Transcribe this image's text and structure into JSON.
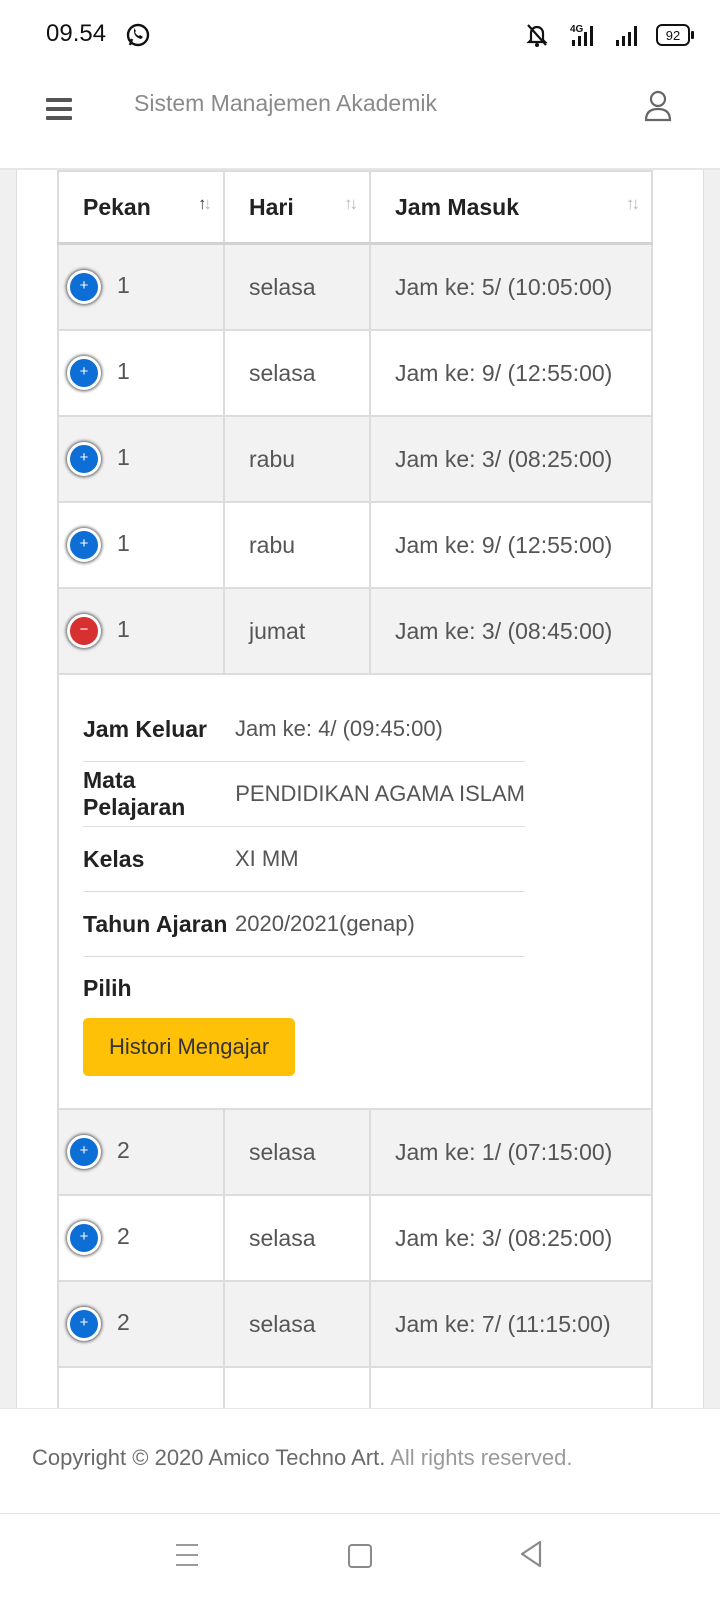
{
  "status_bar": {
    "time": "09.54",
    "battery": "92",
    "network": "4G"
  },
  "header": {
    "title": "Sistem Manajemen Akademik"
  },
  "table": {
    "columns": [
      "Pekan",
      "Hari",
      "Jam Masuk"
    ],
    "rows_before": [
      {
        "pekan": "1",
        "hari": "selasa",
        "jam_masuk": "Jam ke: 5/ (10:05:00)"
      },
      {
        "pekan": "1",
        "hari": "selasa",
        "jam_masuk": "Jam ke: 9/ (12:55:00)"
      },
      {
        "pekan": "1",
        "hari": "rabu",
        "jam_masuk": "Jam ke: 3/ (08:25:00)"
      },
      {
        "pekan": "1",
        "hari": "rabu",
        "jam_masuk": "Jam ke: 9/ (12:55:00)"
      }
    ],
    "expanded_row": {
      "pekan": "1",
      "hari": "jumat",
      "jam_masuk": "Jam ke: 3/ (08:45:00)"
    },
    "detail": {
      "jam_keluar_label": "Jam Keluar",
      "jam_keluar": "Jam ke: 4/ (09:45:00)",
      "mapel_label": "Mata Pelajaran",
      "mapel": "PENDIDIKAN AGAMA ISLAM",
      "kelas_label": "Kelas",
      "kelas": "XI MM",
      "tahun_label": "Tahun Ajaran",
      "tahun": "2020/2021(genap)",
      "pilih_label": "Pilih",
      "button_label": "Histori Mengajar"
    },
    "rows_after": [
      {
        "pekan": "2",
        "hari": "selasa",
        "jam_masuk": "Jam ke: 1/ (07:15:00)"
      },
      {
        "pekan": "2",
        "hari": "selasa",
        "jam_masuk": "Jam ke: 3/ (08:25:00)"
      },
      {
        "pekan": "2",
        "hari": "selasa",
        "jam_masuk": "Jam ke: 7/ (11:15:00)"
      }
    ]
  },
  "footer": {
    "copyright": "Copyright © 2020 Amico Techno Art.",
    "rights": "All rights reserved."
  },
  "colors": {
    "plus": "#0d6fd6",
    "minus": "#d63030",
    "button": "#ffc107"
  }
}
